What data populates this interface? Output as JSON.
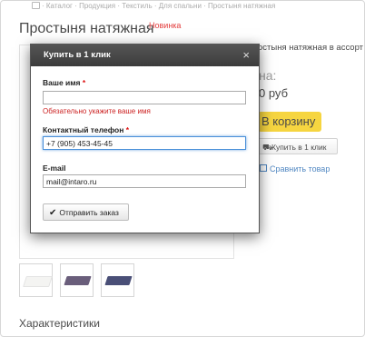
{
  "breadcrumb": "· Каталог · Продукция · Текстиль · Для спальни · Простыня натяжная",
  "product": {
    "title": "Простыня натяжная",
    "badge": "Новинка",
    "side_name": "остыня натяжная в ассорт",
    "price_label": "на:",
    "price": "0 руб",
    "cart_button": "В корзину",
    "oneclick_button": "Купить в 1 клик",
    "compare_link": "Сравнить товар",
    "thumbnails": [
      {
        "color": "#f2f2ef",
        "icon": "sheet-white-thumbnail"
      },
      {
        "color": "#4a3b5e",
        "icon": "sheet-purple-thumbnail"
      },
      {
        "color": "#23295a",
        "icon": "sheet-navy-thumbnail"
      }
    ],
    "section_title": "Характеристики"
  },
  "modal": {
    "title": "Купить в 1 клик",
    "close": "×",
    "name_label": "Ваше имя",
    "name_value": "",
    "name_error": "Обязательно укажите ваше имя",
    "phone_label": "Контактный телефон",
    "phone_value": "+7 (905) 453-45-45",
    "email_label": "E-mail",
    "email_value": "mail@intaro.ru",
    "required_mark": "*",
    "submit": "Отправить заказ"
  },
  "colors": {
    "accent_yellow": "#f5cc16",
    "link_blue": "#2a6db5",
    "error_red": "#cc2222"
  }
}
